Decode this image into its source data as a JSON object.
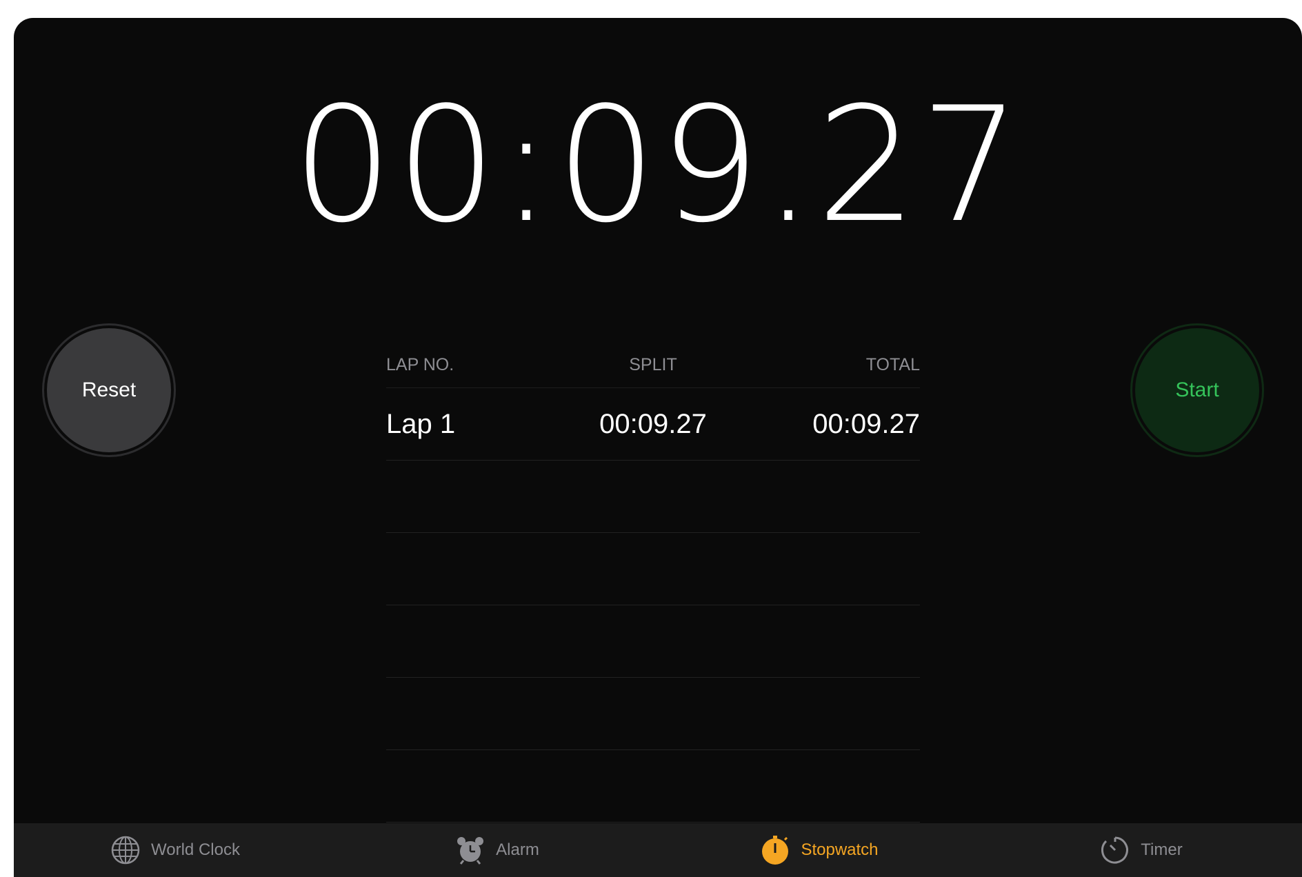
{
  "stopwatch": {
    "display_time": "00:09.27",
    "reset_label": "Reset",
    "start_label": "Start"
  },
  "laps": {
    "headers": {
      "lap_no": "LAP NO.",
      "split": "SPLIT",
      "total": "TOTAL"
    },
    "rows": [
      {
        "lap": "Lap 1",
        "split": "00:09.27",
        "total": "00:09.27"
      }
    ]
  },
  "tabbar": {
    "tabs": [
      {
        "label": "World Clock",
        "icon": "globe-icon",
        "active": false
      },
      {
        "label": "Alarm",
        "icon": "alarm-clock-icon",
        "active": false
      },
      {
        "label": "Stopwatch",
        "icon": "stopwatch-icon",
        "active": true
      },
      {
        "label": "Timer",
        "icon": "timer-icon",
        "active": false
      }
    ]
  },
  "colors": {
    "background": "#0a0a0a",
    "accent": "#f5a623",
    "start_green": "#35c35a",
    "inactive_tab": "#8e8e93"
  }
}
